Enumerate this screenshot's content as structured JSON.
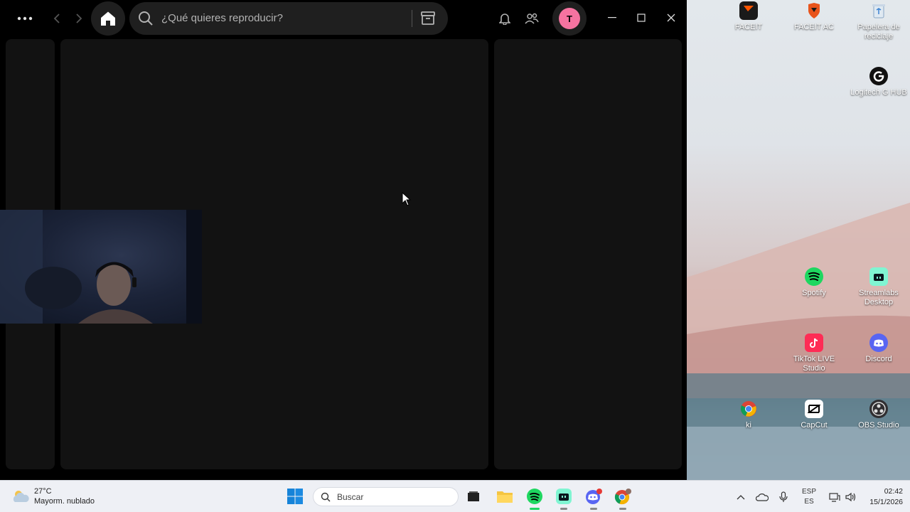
{
  "spotify": {
    "search_placeholder": "¿Qué quieres reproducir?",
    "avatar_initial": "T",
    "accent_color": "#1ed760",
    "avatar_color": "#f573a0"
  },
  "desktop": {
    "icons": [
      {
        "label": "FACEIT"
      },
      {
        "label": "FACEIT AC"
      },
      {
        "label": "Papelera de reciclaje"
      },
      {
        "label": "Logitech G HUB"
      },
      {
        "label": "Spotify"
      },
      {
        "label": "Streamlabs Desktop"
      },
      {
        "label": "TikTok LIVE Studio"
      },
      {
        "label": "Discord"
      },
      {
        "label": "ki"
      },
      {
        "label": "CapCut"
      },
      {
        "label": "OBS Studio"
      }
    ]
  },
  "taskbar": {
    "weather_temp": "27°C",
    "weather_desc": "Mayorm. nublado",
    "search_label": "Buscar",
    "language_top": "ESP",
    "language_bottom": "ES",
    "time": "02:42",
    "date": "15/1/2026"
  }
}
